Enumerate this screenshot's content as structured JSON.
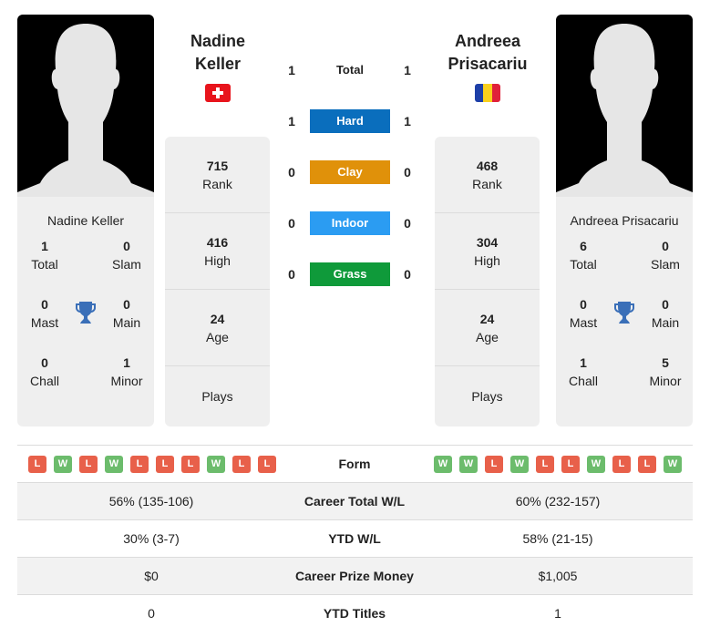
{
  "player1": {
    "name_line1": "Nadine",
    "name_line2": "Keller",
    "full_name": "Nadine Keller",
    "flag": "switzerland-flag",
    "titles": {
      "total": {
        "value": "1",
        "label": "Total"
      },
      "slam": {
        "value": "0",
        "label": "Slam"
      },
      "mast": {
        "value": "0",
        "label": "Mast"
      },
      "main": {
        "value": "0",
        "label": "Main"
      },
      "chall": {
        "value": "0",
        "label": "Chall"
      },
      "minor": {
        "value": "1",
        "label": "Minor"
      }
    },
    "stats": {
      "rank": {
        "value": "715",
        "label": "Rank"
      },
      "high": {
        "value": "416",
        "label": "High"
      },
      "age": {
        "value": "24",
        "label": "Age"
      },
      "plays": {
        "value": "",
        "label": "Plays"
      }
    },
    "form": [
      "L",
      "W",
      "L",
      "W",
      "L",
      "L",
      "L",
      "W",
      "L",
      "L"
    ]
  },
  "player2": {
    "name_line1": "Andreea",
    "name_line2": "Prisacariu",
    "full_name": "Andreea Prisacariu",
    "flag": "romania-flag",
    "titles": {
      "total": {
        "value": "6",
        "label": "Total"
      },
      "slam": {
        "value": "0",
        "label": "Slam"
      },
      "mast": {
        "value": "0",
        "label": "Mast"
      },
      "main": {
        "value": "0",
        "label": "Main"
      },
      "chall": {
        "value": "1",
        "label": "Chall"
      },
      "minor": {
        "value": "5",
        "label": "Minor"
      }
    },
    "stats": {
      "rank": {
        "value": "468",
        "label": "Rank"
      },
      "high": {
        "value": "304",
        "label": "High"
      },
      "age": {
        "value": "24",
        "label": "Age"
      },
      "plays": {
        "value": "",
        "label": "Plays"
      }
    },
    "form": [
      "W",
      "W",
      "L",
      "W",
      "L",
      "L",
      "W",
      "L",
      "L",
      "W"
    ]
  },
  "h2h": [
    {
      "label": "Total",
      "p1": "1",
      "p2": "1",
      "color": ""
    },
    {
      "label": "Hard",
      "p1": "1",
      "p2": "1",
      "color": "#0a6ebd"
    },
    {
      "label": "Clay",
      "p1": "0",
      "p2": "0",
      "color": "#e0910a"
    },
    {
      "label": "Indoor",
      "p1": "0",
      "p2": "0",
      "color": "#2b9cf2"
    },
    {
      "label": "Grass",
      "p1": "0",
      "p2": "0",
      "color": "#0f9a3a"
    }
  ],
  "table": {
    "form_label": "Form",
    "rows": [
      {
        "label": "Career Total W/L",
        "p1": "56% (135-106)",
        "p2": "60% (232-157)"
      },
      {
        "label": "YTD W/L",
        "p1": "30% (3-7)",
        "p2": "58% (21-15)"
      },
      {
        "label": "Career Prize Money",
        "p1": "$0",
        "p2": "$1,005"
      },
      {
        "label": "YTD Titles",
        "p1": "0",
        "p2": "1"
      }
    ]
  },
  "colors": {
    "win": "#6cbc6c",
    "loss": "#e8604a",
    "trophy": "#3a6fb8"
  }
}
